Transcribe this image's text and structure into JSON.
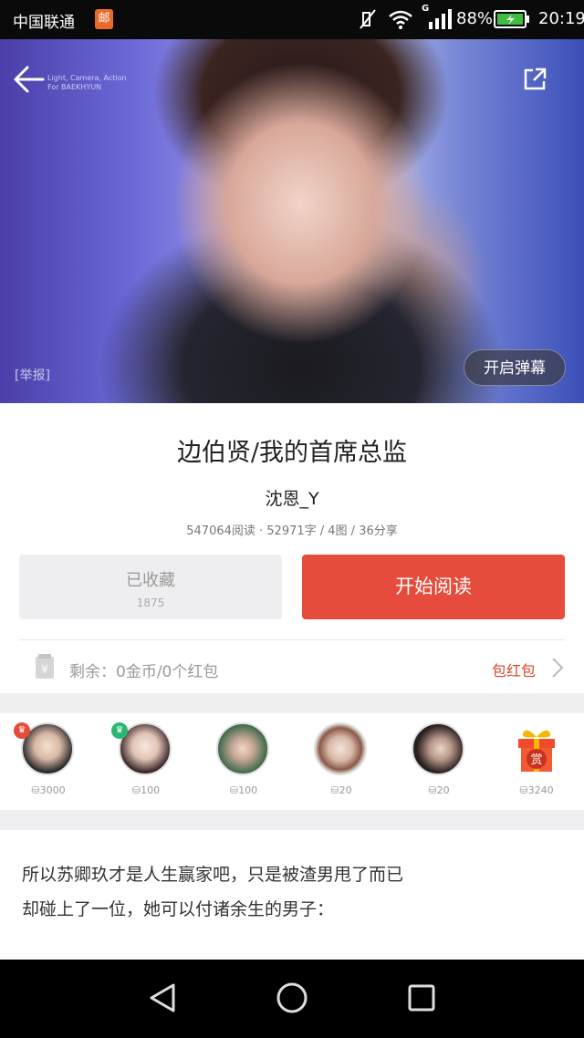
{
  "status_bar": {
    "carrier": "中国联通",
    "carrier_badge": "邮",
    "g_mark": "G",
    "battery": "88%",
    "time": "20:19"
  },
  "hero": {
    "watermark_line1": "Light, Camera, Action",
    "watermark_line2": "For BAEKHYUN",
    "report": "[举报]",
    "danmaku_toggle": "开启弹幕"
  },
  "book": {
    "title": "边伯贤/我的首席总监",
    "author": "沈恩_Y",
    "stats": "547064阅读 · 52971字 / 4图 / 36分享"
  },
  "actions": {
    "favorite_label": "已收藏",
    "favorite_count": "1875",
    "read_label": "开始阅读"
  },
  "wallet": {
    "balance": "剩余：0金币/0个红包",
    "redpack": "包红包"
  },
  "supporters": [
    {
      "amount": "3000",
      "badge": "crown",
      "badge_color": "#e64c3c"
    },
    {
      "amount": "100",
      "badge": "crown",
      "badge_color": "#2bb673"
    },
    {
      "amount": "100"
    },
    {
      "amount": "20"
    },
    {
      "amount": "20"
    },
    {
      "amount": "3240",
      "icon": "reward-gift-icon",
      "reward_char": "赏"
    }
  ],
  "excerpt": {
    "line1": "所以苏卿玖才是人生赢家吧，只是被渣男甩了而已",
    "line2": "却碰上了一位，她可以付诸余生的男子："
  },
  "colors": {
    "accent": "#e64c3c",
    "link": "#d9472b"
  }
}
